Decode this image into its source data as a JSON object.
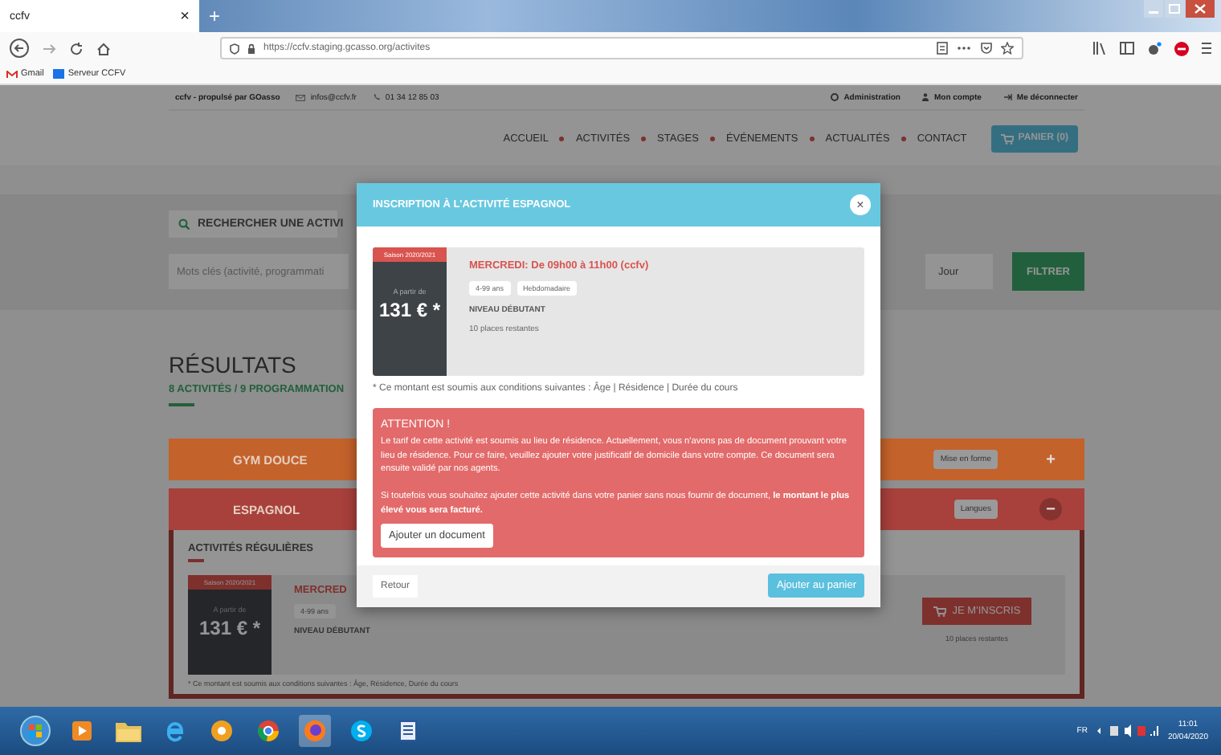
{
  "browser": {
    "tab": {
      "title": "ccfv",
      "close": "×"
    },
    "new_tab": "+",
    "url": "https://ccfv.staging.gcasso.org/activites",
    "bookmarks": [
      "Gmail",
      "Serveur CCFV"
    ]
  },
  "site": {
    "brand": "ccfv - propulsé par GOasso",
    "email": "infos@ccfv.fr",
    "phone": "01 34 12 85 03",
    "account_links": [
      "Administration",
      "Mon compte",
      "Me déconnecter"
    ],
    "nav": [
      "ACCUEIL",
      "ACTIVITÉS",
      "STAGES",
      "ÉVÉNEMENTS",
      "ACTUALITÉS",
      "CONTACT"
    ],
    "cart": "PANIER (0)"
  },
  "search": {
    "tab": "RECHERCHER UNE ACTIVI",
    "keywords_placeholder": "Mots clés (activité, programmati",
    "day": "Jour",
    "filter": "FILTRER"
  },
  "results": {
    "title": "RÉSULTATS",
    "subtitle": "8 ACTIVITÉS / 9 PROGRAMMATION",
    "activities": [
      {
        "name": "GYM DOUCE",
        "tag": "Mise en forme",
        "toggle": "+",
        "color": "#c4622b",
        "expanded": false
      },
      {
        "name": "ESPAGNOL",
        "tag": "Langues",
        "toggle": "−",
        "color": "#a8403c",
        "expanded": true,
        "section": {
          "title": "ACTIVITÉS RÉGULIÈRES",
          "session": {
            "season": "Saison 2020/2021",
            "from": "A partir de",
            "price": "131 € *",
            "day": "MERCRED",
            "tags": [
              "4-99 ans"
            ],
            "level": "NIVEAU DÉBUTANT",
            "register": "JE M'INSCRIS",
            "places": "10 places restantes"
          },
          "note": "* Ce montant est soumis aux conditions suivantes : Âge, Résidence, Durée du cours"
        }
      }
    ]
  },
  "modal": {
    "title": "INSCRIPTION À L'ACTIVITÉ ESPAGNOL",
    "close": "×",
    "session": {
      "season": "Saison 2020/2021",
      "from": "A partir de",
      "price": "131 € *",
      "schedule": "MERCREDI:  De 09h00 à 11h00  (ccfv)",
      "tags": [
        "4-99 ans",
        "Hebdomadaire"
      ],
      "level": "NIVEAU DÉBUTANT",
      "places": "10 places restantes"
    },
    "note": "* Ce montant est soumis aux conditions suivantes : Âge | Résidence | Durée du cours",
    "alert": {
      "title": "ATTENTION !",
      "paragraphs": [
        "Le tarif de cette activité est soumis au lieu de résidence. Actuellement, vous n'avons pas de document prouvant votre lieu de résidence. Pour ce faire, veuillez ajouter votre justificatif de domicile dans votre compte. Ce document sera ensuite validé par nos agents.",
        "Si toutefois vous souhaitez ajouter cette activité dans votre panier sans nous fournir de document, **le montant le plus élevé vous sera facturé.**"
      ],
      "button": "Ajouter un document"
    },
    "back": "Retour",
    "add": "Ajouter au panier"
  },
  "taskbar": {
    "language": "FR",
    "time": "11:01",
    "date": "20/04/2020"
  }
}
